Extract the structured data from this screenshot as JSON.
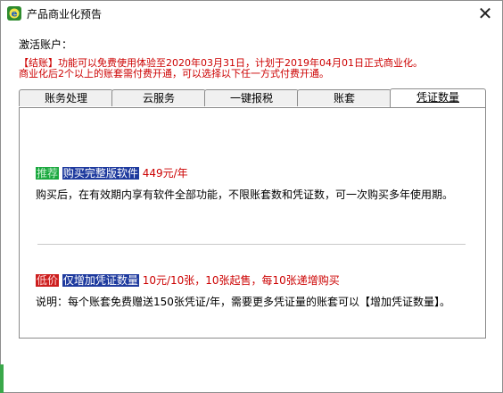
{
  "window": {
    "title": "产品商业化预告",
    "close": "✕"
  },
  "account_label": "激活账户：",
  "notice": {
    "line1": "【结账】功能可以免费使用体验至2020年03月31日，计划于2019年04月01日正式商业化。",
    "line2": "商业化后2个以上的账套需付费开通，可以选择以下任一方式付费开通。"
  },
  "tabs": [
    {
      "label": "账务处理"
    },
    {
      "label": "云服务"
    },
    {
      "label": "一键报税"
    },
    {
      "label": "账套"
    },
    {
      "label": "凭证数量"
    }
  ],
  "active_tab": "凭证数量",
  "offer1": {
    "tag": "推荐",
    "link": "购买完整版软件",
    "price": "449元/年",
    "desc": "购买后，在有效期内享有软件全部功能，不限账套数和凭证数，可一次购买多年使用期。"
  },
  "offer2": {
    "tag": "低价",
    "link": "仅增加凭证数量",
    "price": "10元/10张，10张起售，每10张递增购买",
    "desc": "说明：每个账套免费赠送150张凭证/年，需要更多凭证量的账套可以【增加凭证数量】。"
  },
  "colors": {
    "notice": "#cc0000",
    "badge_green": "#1aa83e",
    "badge_blue": "#1e3a9e",
    "badge_red": "#cc1e1e"
  }
}
